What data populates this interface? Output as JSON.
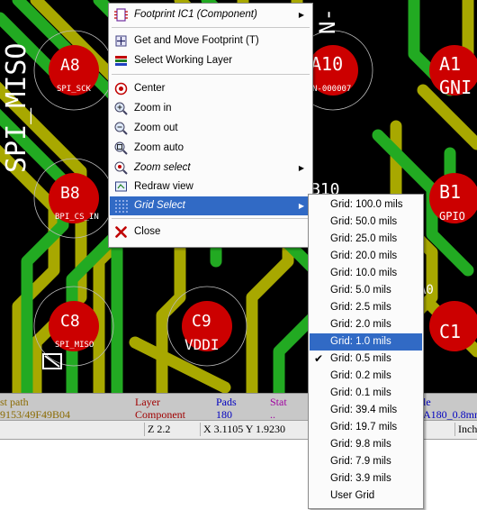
{
  "pcb": {
    "pads": [
      {
        "name": "A8",
        "net": "SPI_SCK"
      },
      {
        "name": "A10",
        "net": "N-000007"
      },
      {
        "name": "A1",
        "net": "GNI"
      },
      {
        "name": "B8",
        "net": "BPI_CS_IN"
      },
      {
        "name": "B10",
        "net": ""
      },
      {
        "name": "B1",
        "net": "GPIO"
      },
      {
        "name": "C8",
        "net": "SPI_MISO"
      },
      {
        "name": "C9",
        "net": "VDDI"
      },
      {
        "name": "C1",
        "net": ""
      }
    ],
    "vertical_net": "SPI_MISO",
    "top_fragment": "N-",
    "right_fragment": "A0"
  },
  "message_panel": {
    "col1_header": "st path",
    "col1_value": "9153/49F49B04",
    "layer_header": "Layer",
    "layer_value": "Component",
    "pads_header": "Pads",
    "pads_value": "180",
    "stat_header": "Stat",
    "stat_value": "..",
    "last_header": "le",
    "last_value": "A180_0.8mn"
  },
  "status_bar": {
    "zoom": "Z 2.2",
    "coords": "X 3.1105  Y 1.9230",
    "units": "Inch"
  },
  "context_menu": {
    "items": [
      {
        "label": "Footprint IC1 (Component)",
        "icon": "footprint-icon",
        "italic": true,
        "submenu": true
      },
      {
        "label": "Get and Move Footprint (T)",
        "icon": "move-footprint-icon"
      },
      {
        "label": "Select Working Layer",
        "icon": "layers-icon"
      },
      {
        "label": "Center",
        "icon": "center-icon"
      },
      {
        "label": "Zoom in",
        "icon": "zoom-in-icon"
      },
      {
        "label": "Zoom out",
        "icon": "zoom-out-icon"
      },
      {
        "label": "Zoom auto",
        "icon": "zoom-auto-icon"
      },
      {
        "label": "Zoom select",
        "icon": "zoom-select-icon",
        "italic": true,
        "submenu": true
      },
      {
        "label": "Redraw view",
        "icon": "redraw-icon"
      },
      {
        "label": "Grid Select",
        "icon": "grid-icon",
        "italic": true,
        "submenu": true,
        "highlighted": true
      },
      {
        "label": "Close",
        "icon": "close-icon"
      }
    ]
  },
  "grid_menu": {
    "items": [
      "Grid: 100.0 mils",
      "Grid: 50.0 mils",
      "Grid: 25.0 mils",
      "Grid: 20.0 mils",
      "Grid: 10.0 mils",
      "Grid: 5.0 mils",
      "Grid: 2.5 mils",
      "Grid: 2.0 mils",
      "Grid: 1.0 mils",
      "Grid: 0.5 mils",
      "Grid: 0.2 mils",
      "Grid: 0.1 mils",
      "Grid: 39.4 mils",
      "Grid: 19.7 mils",
      "Grid: 9.8 mils",
      "Grid: 7.9 mils",
      "Grid: 3.9 mils",
      "User Grid"
    ],
    "highlighted_index": 8,
    "checked_index": 9
  },
  "colors": {
    "pad_red": "#cc0000",
    "trace_green": "#22aa22",
    "trace_olive": "#a8a800",
    "menu_highlight": "#316ac5"
  }
}
